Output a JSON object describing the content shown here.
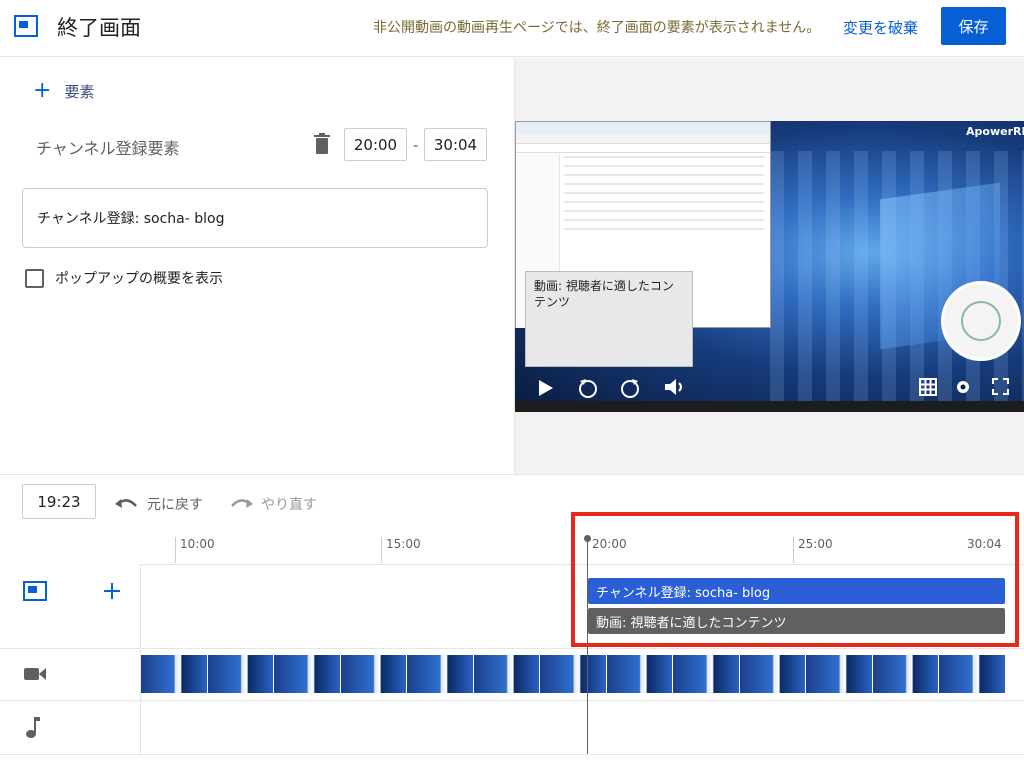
{
  "header": {
    "title": "終了画面",
    "notice": "非公開動画の動画再生ページでは、終了画面の要素が表示されません。",
    "discard_label": "変更を破棄",
    "save_label": "保存"
  },
  "editor": {
    "add_element_label": "要素",
    "element_type_label": "チャンネル登録要素",
    "start_time": "20:00",
    "time_separator": "-",
    "end_time": "30:04",
    "element_text": "チャンネル登録: socha- blog",
    "checkbox_label": "ポップアップの概要を表示",
    "checkbox_checked": false
  },
  "preview": {
    "watermark": "ApowerREC",
    "tooltip_text": "動画: 視聴者に適したコンテンツ"
  },
  "timeline": {
    "current_time": "19:23",
    "undo_label": "元に戻す",
    "redo_label": "やり直す",
    "ticks": [
      "10:00",
      "15:00",
      "20:00",
      "25:00",
      "30:04"
    ],
    "clips": [
      {
        "label": "チャンネル登録: socha- blog",
        "color": "#2b5fd6"
      },
      {
        "label": "動画: 視聴者に適したコンテンツ",
        "color": "#606060"
      }
    ],
    "highlight_color": "#e8281d"
  },
  "colors": {
    "accent": "#065fd4"
  }
}
